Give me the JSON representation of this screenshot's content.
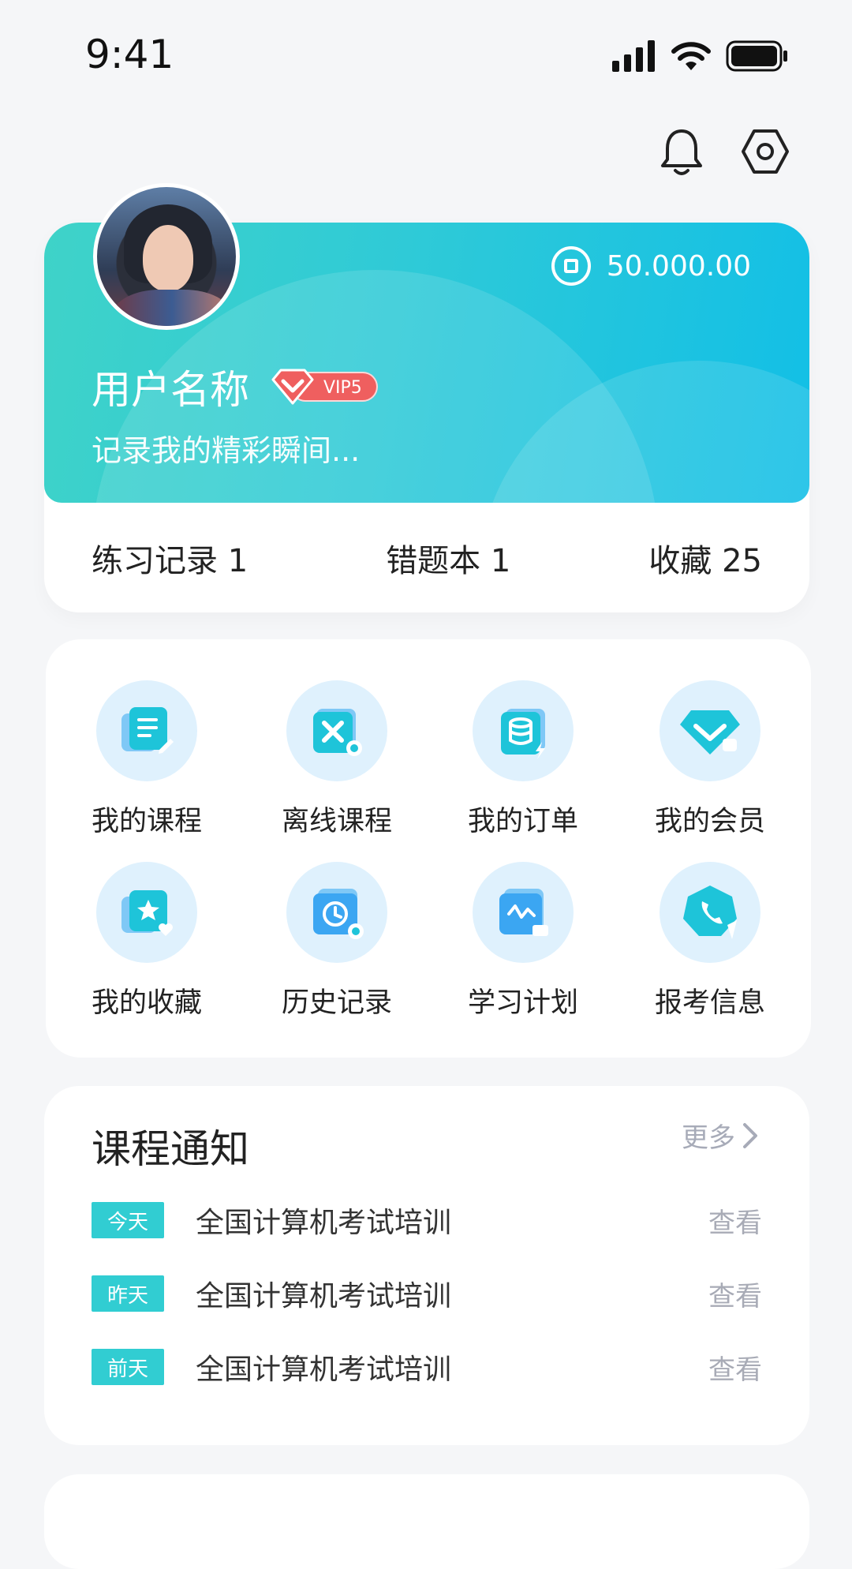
{
  "status_bar": {
    "time": "9:41"
  },
  "profile": {
    "coin_balance": "50.000.00",
    "username": "用户名称",
    "vip_level": "VIP5",
    "signature": "记录我的精彩瞬间...",
    "stats": [
      {
        "label": "练习记录 1"
      },
      {
        "label": "错题本 1"
      },
      {
        "label": "收藏 25"
      }
    ]
  },
  "features": [
    {
      "label": "我的课程",
      "icon": "course-icon"
    },
    {
      "label": "离线课程",
      "icon": "offline-course-icon"
    },
    {
      "label": "我的订单",
      "icon": "order-icon"
    },
    {
      "label": "我的会员",
      "icon": "membership-icon"
    },
    {
      "label": "我的收藏",
      "icon": "favorites-icon"
    },
    {
      "label": "历史记录",
      "icon": "history-icon"
    },
    {
      "label": "学习计划",
      "icon": "study-plan-icon"
    },
    {
      "label": "报考信息",
      "icon": "exam-info-icon"
    }
  ],
  "notices": {
    "title": "课程通知",
    "more_label": "更多",
    "items": [
      {
        "tag": "今天",
        "text": "全国计算机考试培训",
        "action": "查看"
      },
      {
        "tag": "昨天",
        "text": "全国计算机考试培训",
        "action": "查看"
      },
      {
        "tag": "前天",
        "text": "全国计算机考试培训",
        "action": "查看"
      }
    ]
  },
  "colors": {
    "accent": "#31cdd2",
    "vip": "#ef5f5f",
    "icon_bg": "#dff1fd",
    "icon_fg": "#1ec4d9"
  }
}
